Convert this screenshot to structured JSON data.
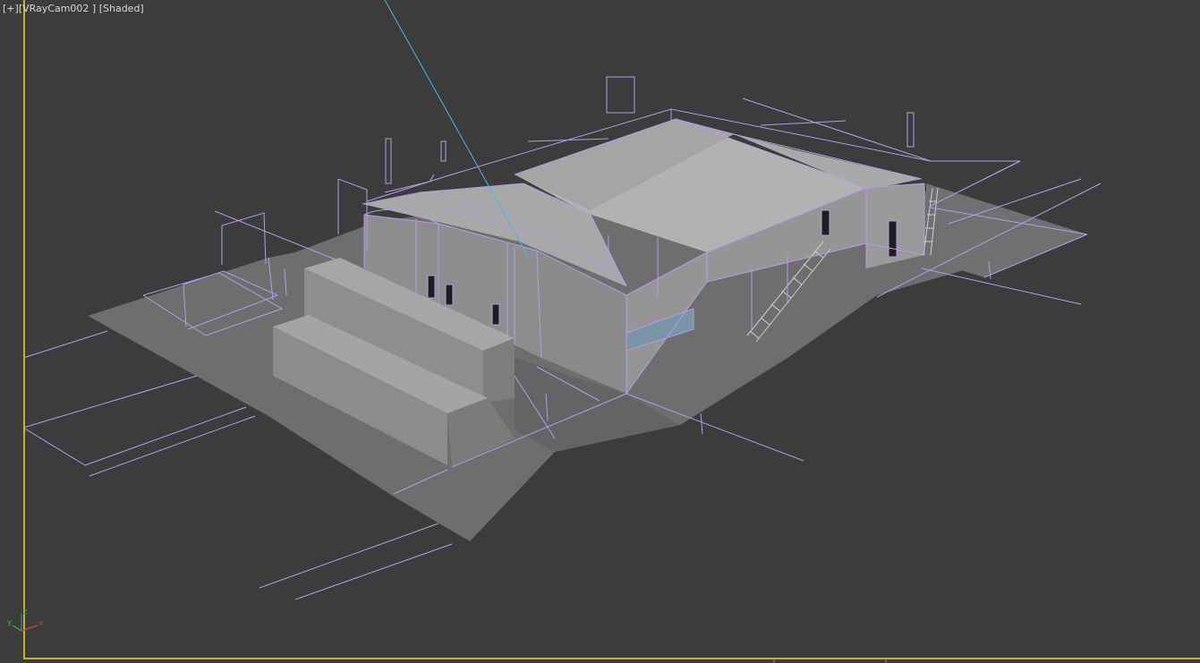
{
  "viewport": {
    "plus_menu": "[+]",
    "camera_menu": "[VRayCam002 ]",
    "shading_menu": "[Shaded]",
    "active_border_color": "#c9b027",
    "background_color": "#3c3c3c",
    "wire_color": "#b79be6",
    "camera_target_line_color": "#49b8e8"
  },
  "axis_gizmo": {
    "y_label": "y",
    "z_label": "z",
    "x_label": "x"
  }
}
